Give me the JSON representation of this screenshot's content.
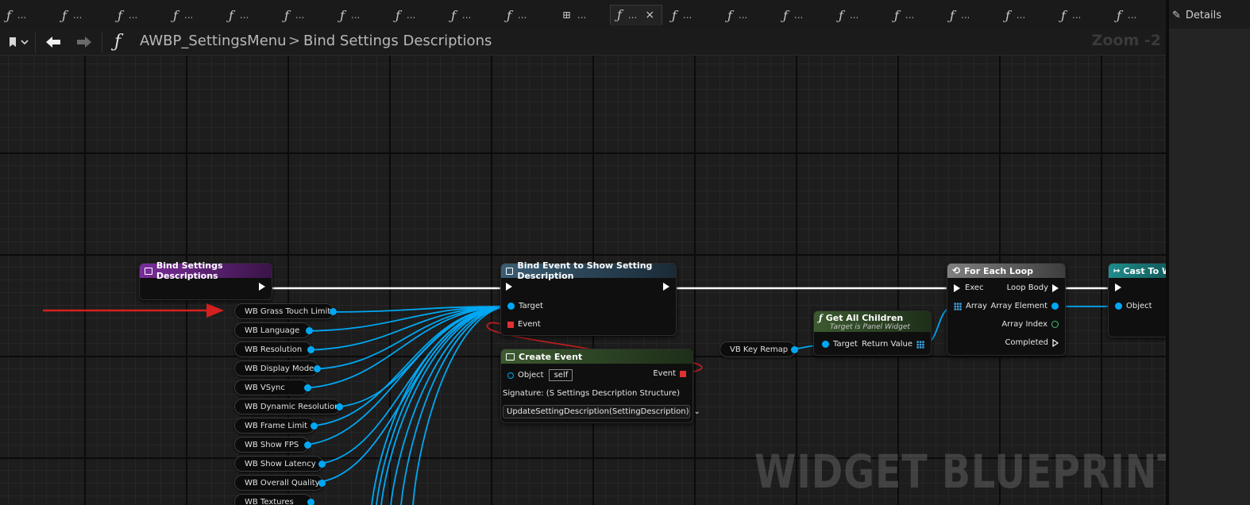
{
  "tabs": [
    {
      "icon": "function-icon",
      "label": "..."
    },
    {
      "icon": "function-icon",
      "label": "..."
    },
    {
      "icon": "function-icon",
      "label": "..."
    },
    {
      "icon": "function-icon",
      "label": "..."
    },
    {
      "icon": "function-icon",
      "label": "..."
    },
    {
      "icon": "function-icon",
      "label": "..."
    },
    {
      "icon": "function-icon",
      "label": "..."
    },
    {
      "icon": "function-icon",
      "label": "..."
    },
    {
      "icon": "function-icon",
      "label": "..."
    },
    {
      "icon": "function-icon",
      "label": "..."
    },
    {
      "icon": "graph-nodes-icon",
      "label": "..."
    },
    {
      "icon": "function-icon",
      "label": "...",
      "active": true,
      "close": "×"
    },
    {
      "icon": "function-icon",
      "label": "..."
    },
    {
      "icon": "function-icon",
      "label": "..."
    },
    {
      "icon": "function-icon",
      "label": "..."
    },
    {
      "icon": "function-icon",
      "label": "..."
    },
    {
      "icon": "function-icon",
      "label": "..."
    },
    {
      "icon": "function-icon",
      "label": "..."
    },
    {
      "icon": "function-icon",
      "label": "..."
    },
    {
      "icon": "function-icon",
      "label": "..."
    },
    {
      "icon": "function-icon",
      "label": "..."
    }
  ],
  "details_panel": {
    "title": "Details",
    "icon": "pencil-icon"
  },
  "toolbar": {
    "bookmark_icon": "bookmark-icon",
    "back_icon": "arrow-left-icon",
    "forward_icon": "arrow-right-icon",
    "function_glyph": "ƒ",
    "blueprint_name": "AWBP_SettingsMenu",
    "separator": ">",
    "graph_name": "Bind Settings Descriptions",
    "zoom": "Zoom -2"
  },
  "nodes": {
    "entry": {
      "title": "Bind Settings Descriptions",
      "color": "#7a2e9a"
    },
    "bind_event": {
      "title": "Bind Event to Show Setting Description",
      "pin_target": "Target",
      "pin_event": "Event",
      "color": "#3a5d74"
    },
    "create_event": {
      "title": "Create Event",
      "pin_object": "Object",
      "object_value": "self",
      "pin_event": "Event",
      "signature": "Signature: (S Settings Description Structure)",
      "function_select": "UpdateSettingDescription(SettingDescription)"
    },
    "get_all_children": {
      "title": "Get All Children",
      "subtitle": "Target is Panel Widget",
      "pin_target": "Target",
      "pin_return": "Return Value",
      "color": "#3c5a30"
    },
    "for_each_loop": {
      "title": "For Each Loop",
      "pin_exec": "Exec",
      "pin_array": "Array",
      "pin_loop_body": "Loop Body",
      "pin_array_element": "Array Element",
      "pin_array_index": "Array Index",
      "pin_completed": "Completed"
    },
    "cast": {
      "title": "Cast To WBI",
      "pin_object": "Object",
      "color": "#1f8c8c"
    }
  },
  "variables": [
    "WB Grass Touch Limit",
    "WB Language",
    "WB Resolution",
    "WB Display Mode",
    "WB VSync",
    "WB Dynamic Resolution",
    "WB Frame Limit",
    "WB Show FPS",
    "WB Show Latency",
    "WB Overall Quality",
    "WB Textures"
  ],
  "vb_key_remap": "VB Key Remap",
  "watermark": "WIDGET BLUEPRINT",
  "colors": {
    "exec": "#ffffff",
    "object_pin": "#00a8f3",
    "delegate_pin": "#e03030",
    "int_pin": "#40c070",
    "annotation_arrow": "#d42020"
  }
}
